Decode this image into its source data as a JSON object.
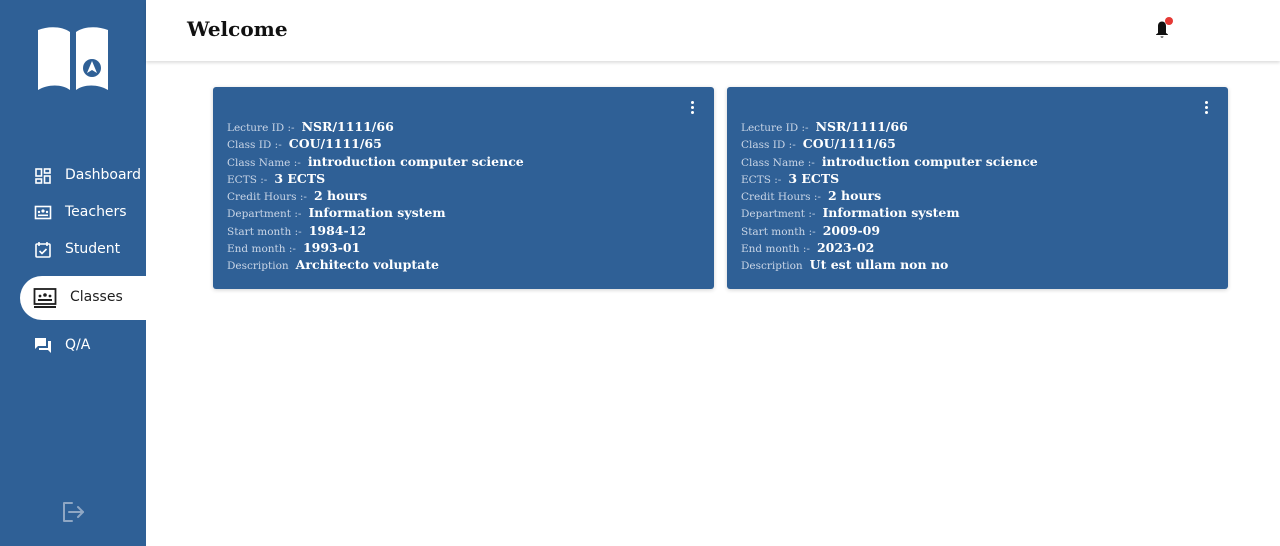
{
  "header": {
    "title": "Welcome"
  },
  "sidebar": {
    "items": [
      {
        "label": "Dashboard",
        "icon": "dashboard-icon"
      },
      {
        "label": "Teachers",
        "icon": "teachers-icon"
      },
      {
        "label": "Student",
        "icon": "student-icon"
      },
      {
        "label": "Classes",
        "icon": "classes-icon",
        "active": true
      },
      {
        "label": "Q/A",
        "icon": "qa-icon"
      }
    ]
  },
  "colors": {
    "primary": "#2f6096",
    "notification_dot": "#e53935"
  },
  "cards": [
    {
      "fields": [
        {
          "label": "Lecture ID :-",
          "value": "NSR/1111/66"
        },
        {
          "label": "Class ID :-",
          "value": "COU/1111/65"
        },
        {
          "label": "Class Name :-",
          "value": "introduction computer science"
        },
        {
          "label": "ECTS :-",
          "value": "3 ECTS"
        },
        {
          "label": "Credit Hours :-",
          "value": "2 hours"
        },
        {
          "label": "Department :-",
          "value": "Information system"
        },
        {
          "label": "Start month :-",
          "value": "1984-12"
        },
        {
          "label": "End month :-",
          "value": "1993-01"
        },
        {
          "label": "Description",
          "value": "Architecto voluptate"
        }
      ]
    },
    {
      "fields": [
        {
          "label": "Lecture ID :-",
          "value": "NSR/1111/66"
        },
        {
          "label": "Class ID :-",
          "value": "COU/1111/65"
        },
        {
          "label": "Class Name :-",
          "value": "introduction computer science"
        },
        {
          "label": "ECTS :-",
          "value": "3 ECTS"
        },
        {
          "label": "Credit Hours :-",
          "value": "2 hours"
        },
        {
          "label": "Department :-",
          "value": "Information system"
        },
        {
          "label": "Start month :-",
          "value": "2009-09"
        },
        {
          "label": "End month :-",
          "value": "2023-02"
        },
        {
          "label": "Description",
          "value": "Ut est ullam non no"
        }
      ]
    }
  ]
}
